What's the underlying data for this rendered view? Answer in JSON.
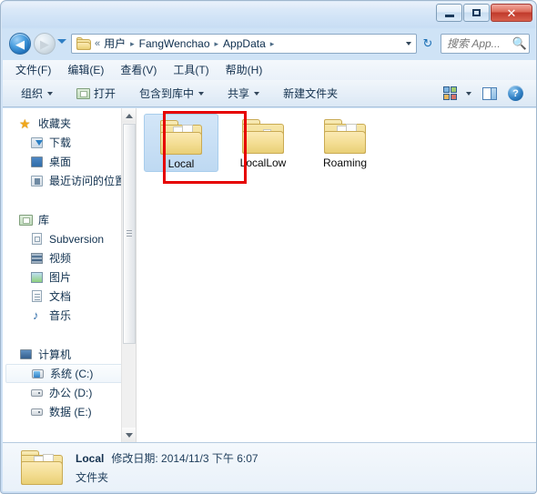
{
  "window": {
    "title": "",
    "caption_buttons": [
      {
        "name": "minimize-button",
        "label": ""
      },
      {
        "name": "maximize-button",
        "label": ""
      },
      {
        "name": "close-button",
        "label": "✕"
      }
    ]
  },
  "navigation": {
    "back_label": "◀",
    "forward_label": "▶",
    "history_dropdown_label": "",
    "refresh_label": "↻",
    "address_chevrons": "«",
    "breadcrumbs": [
      {
        "label": "用户"
      },
      {
        "label": "FangWenchao"
      },
      {
        "label": "AppData"
      }
    ],
    "breadcrumb_separator": "▸",
    "address_dropdown_label": ""
  },
  "search": {
    "placeholder": "搜索 App...",
    "value": "",
    "icon": "search-icon"
  },
  "menubar": {
    "items": [
      {
        "label": "文件(F)"
      },
      {
        "label": "编辑(E)"
      },
      {
        "label": "查看(V)"
      },
      {
        "label": "工具(T)"
      },
      {
        "label": "帮助(H)"
      }
    ]
  },
  "toolbar": {
    "organize_label": "组织",
    "open_label": "打开",
    "include_in_library_label": "包含到库中",
    "share_label": "共享",
    "new_folder_label": "新建文件夹",
    "views_icon": "views-icon",
    "preview_pane_icon": "preview-pane-icon",
    "help_icon": "help-icon",
    "help_glyph": "?"
  },
  "navpane": {
    "groups": [
      {
        "header": {
          "label": "收藏夹",
          "icon": "star-icon"
        },
        "items": [
          {
            "label": "下载",
            "icon": "download-icon"
          },
          {
            "label": "桌面",
            "icon": "desktop-icon"
          },
          {
            "label": "最近访问的位置",
            "icon": "recent-places-icon"
          }
        ]
      },
      {
        "header": {
          "label": "库",
          "icon": "library-icon"
        },
        "items": [
          {
            "label": "Subversion",
            "icon": "subversion-icon"
          },
          {
            "label": "视频",
            "icon": "video-icon"
          },
          {
            "label": "图片",
            "icon": "pictures-icon"
          },
          {
            "label": "文档",
            "icon": "documents-icon"
          },
          {
            "label": "音乐",
            "icon": "music-icon"
          }
        ]
      },
      {
        "header": {
          "label": "计算机",
          "icon": "computer-icon"
        },
        "items": [
          {
            "label": "系统 (C:)",
            "icon": "system-drive-icon",
            "selected": true
          },
          {
            "label": "办公 (D:)",
            "icon": "drive-icon"
          },
          {
            "label": "数据 (E:)",
            "icon": "drive-icon"
          }
        ]
      }
    ],
    "scrollbar": {
      "up_arrow": "▲",
      "down_arrow": "▼"
    }
  },
  "content": {
    "items": [
      {
        "label": "Local",
        "icon": "folder-icon",
        "selected": true
      },
      {
        "label": "LocalLow",
        "icon": "folder-icon",
        "selected": false
      },
      {
        "label": "Roaming",
        "icon": "folder-icon",
        "selected": false
      }
    ]
  },
  "annotation": {
    "color": "#e60000",
    "target": "Local"
  },
  "statusbar": {
    "icon": "folder-icon",
    "name": "Local",
    "modified_label": "修改日期:",
    "modified_value": "2014/11/3 下午 6:07",
    "type": "文件夹"
  },
  "colors": {
    "accent": "#2f7fc4",
    "selection": "#bed9f2",
    "annotation": "#e60000",
    "window_bg": "#cfe3f6"
  }
}
